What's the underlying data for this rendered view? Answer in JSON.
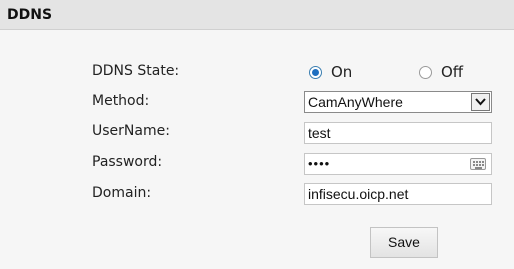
{
  "header": {
    "title": "DDNS"
  },
  "form": {
    "state_label": "DDNS State:",
    "state_on": "On",
    "state_off": "Off",
    "state_selected": "On",
    "method_label": "Method:",
    "method_value": "CamAnyWhere",
    "username_label": "UserName:",
    "username_value": "test",
    "password_label": "Password:",
    "password_value": "••••",
    "domain_label": "Domain:",
    "domain_value": "infisecu.oicp.net"
  },
  "actions": {
    "save_label": "Save"
  },
  "icons": {
    "dropdown": "chevron-down-icon",
    "keyboard": "keyboard-icon"
  },
  "colors": {
    "radio_selected": "#1e6fc0",
    "header_bg": "#e4e4e4"
  }
}
